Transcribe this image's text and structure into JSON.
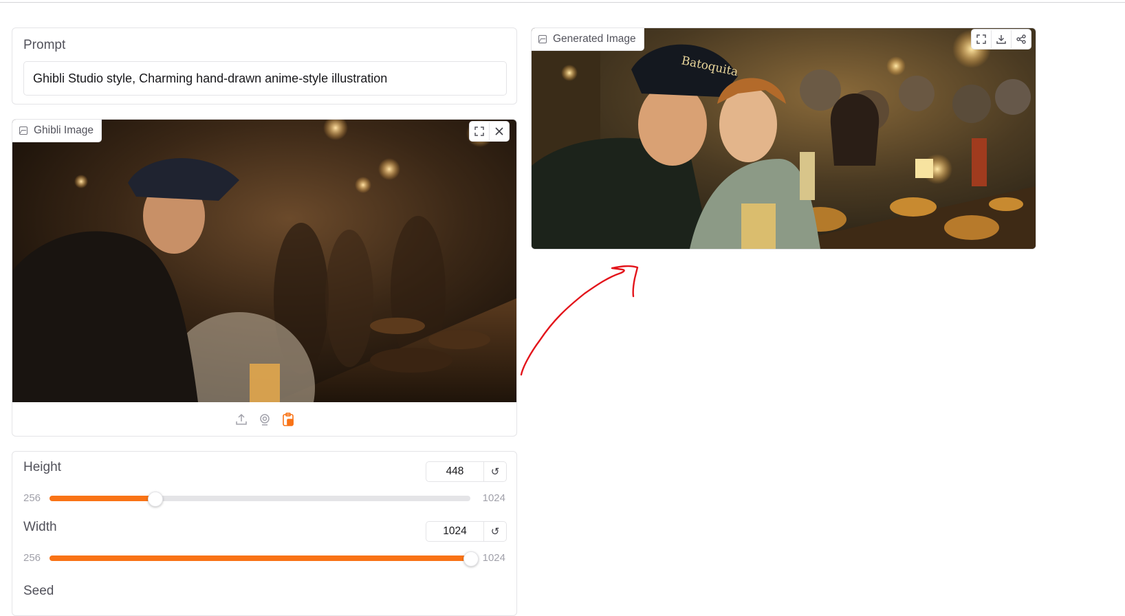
{
  "prompt": {
    "label": "Prompt",
    "value": "Ghibli Studio style, Charming hand-drawn anime-style illustration"
  },
  "input_image": {
    "badge_label": "Ghibli Image",
    "icons": [
      "image-icon",
      "fullscreen-icon",
      "close-icon",
      "upload-icon",
      "webcam-icon",
      "clipboard-icon"
    ]
  },
  "output_image": {
    "badge_label": "Generated Image",
    "cap_text": "Batoquita",
    "icons": [
      "image-icon",
      "fullscreen-icon",
      "download-icon",
      "share-icon"
    ]
  },
  "height_slider": {
    "label": "Height",
    "value": "448",
    "min": "256",
    "max": "1024",
    "fraction": 0.25,
    "reset_glyph": "↺"
  },
  "width_slider": {
    "label": "Width",
    "value": "1024",
    "min": "256",
    "max": "1024",
    "fraction": 1.0,
    "reset_glyph": "↺"
  },
  "seed": {
    "label": "Seed"
  },
  "colors": {
    "accent": "#f97316",
    "annotation": "#e3141b",
    "border": "#e4e4e7"
  }
}
